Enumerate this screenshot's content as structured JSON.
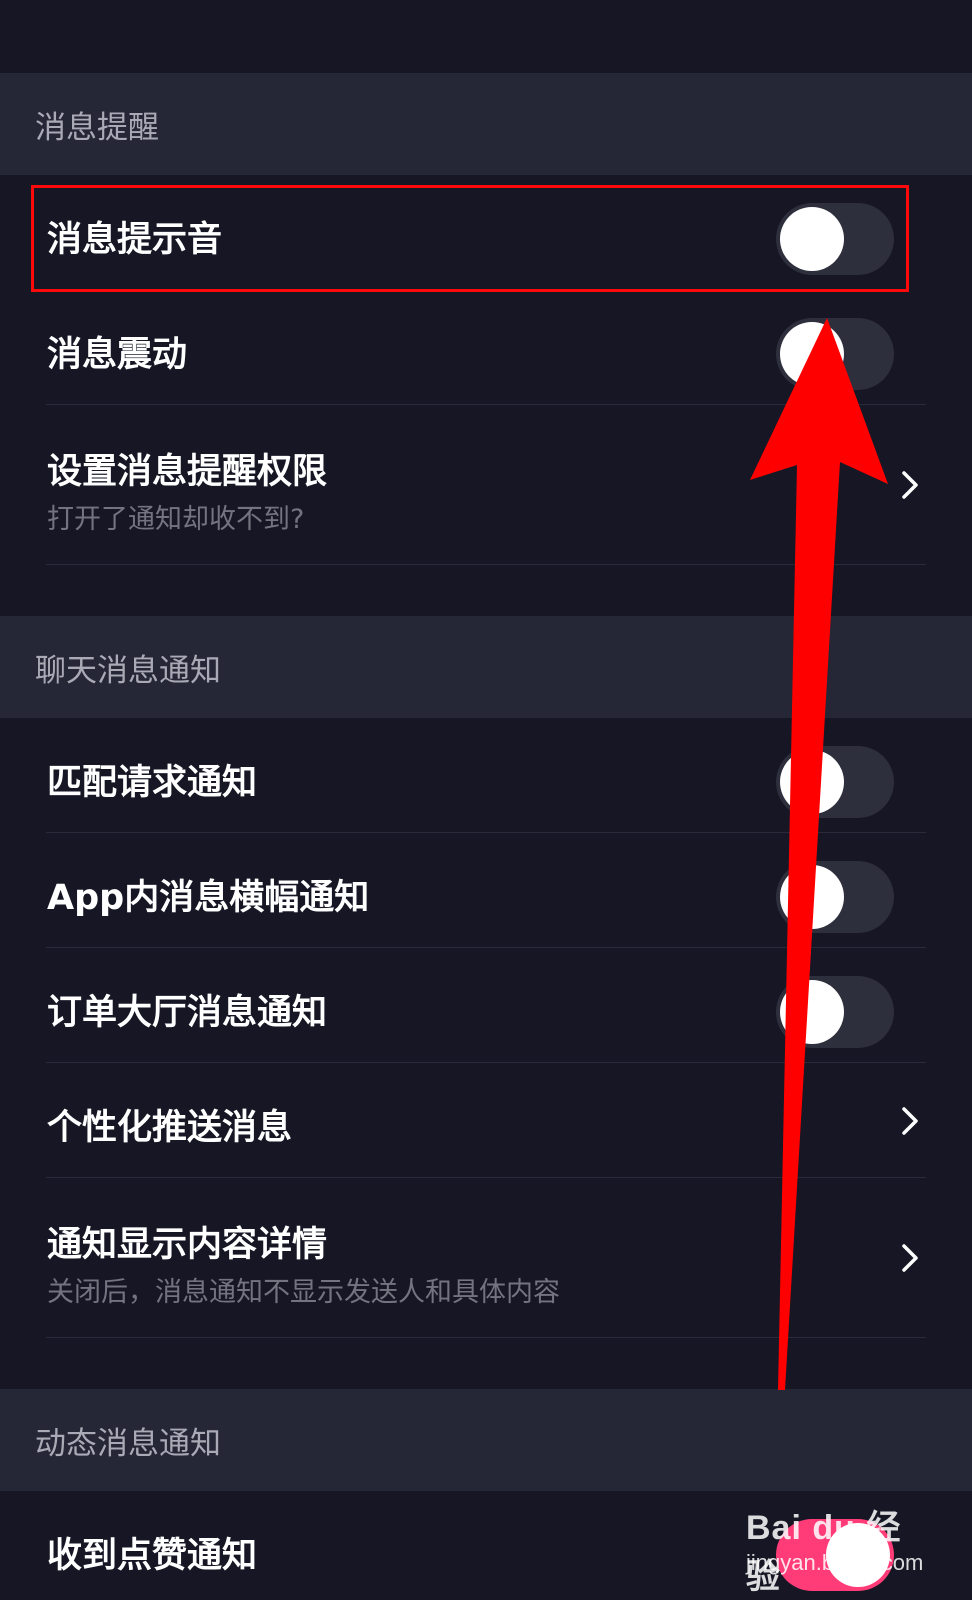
{
  "sections": [
    {
      "header": "消息提醒",
      "items": [
        {
          "title": "消息提示音",
          "control": "toggle",
          "state": "off"
        },
        {
          "title": "消息震动",
          "control": "toggle",
          "state": "off"
        },
        {
          "title": "设置消息提醒权限",
          "subtitle": "打开了通知却收不到?",
          "control": "chevron"
        }
      ]
    },
    {
      "header": "聊天消息通知",
      "items": [
        {
          "title": "匹配请求通知",
          "control": "toggle",
          "state": "off"
        },
        {
          "title": "App内消息横幅通知",
          "control": "toggle",
          "state": "off"
        },
        {
          "title": "订单大厅消息通知",
          "control": "toggle",
          "state": "off"
        },
        {
          "title": "个性化推送消息",
          "control": "chevron"
        },
        {
          "title": "通知显示内容详情",
          "subtitle": "关闭后，消息通知不显示发送人和具体内容",
          "control": "chevron"
        }
      ]
    },
    {
      "header": "动态消息通知",
      "items": [
        {
          "title": "收到点赞通知",
          "control": "toggle",
          "state": "on"
        }
      ]
    }
  ],
  "overlay": {
    "highlight_color": "#ff0a0a",
    "arrow_color": "#ff0000"
  },
  "watermark": {
    "logo": "Bai du 经验",
    "url": "jingyan.baidu.com"
  },
  "colors": {
    "background": "#161624",
    "section_header_bg": "#252636",
    "toggle_off": "#2e2f3c",
    "toggle_on": "#ff3c78"
  },
  "icons": {
    "chevron": "chevron-right-icon",
    "knob": "toggle-knob"
  }
}
